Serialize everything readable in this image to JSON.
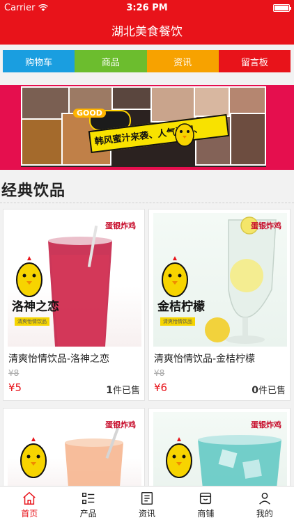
{
  "status": {
    "carrier": "Carrier",
    "time": "3:26 PM"
  },
  "nav": {
    "title": "湖北美食餐饮"
  },
  "menu": [
    {
      "label": "购物车",
      "color": "#1a9ee0"
    },
    {
      "label": "商品",
      "color": "#6cbd2e"
    },
    {
      "label": "资讯",
      "color": "#f7a200"
    },
    {
      "label": "留言板",
      "color": "#e8131a"
    }
  ],
  "banner": {
    "good": "GOOD",
    "slogan": "韩风蜜汁来袭、人气满棚、"
  },
  "section": {
    "title": "经典饮品"
  },
  "products": [
    {
      "brand": "蛋银炸鸡",
      "label": "洛神之恋",
      "sublabel": "清爽怡情饮品",
      "name": "清爽怡情饮品-洛神之恋",
      "old_price": "¥8",
      "price": "¥5",
      "sold_count": "1",
      "sold_suffix": "件已售"
    },
    {
      "brand": "蛋银炸鸡",
      "label": "金桔柠檬",
      "sublabel": "清爽怡情饮品",
      "name": "清爽怡情饮品-金桔柠檬",
      "old_price": "¥8",
      "price": "¥6",
      "sold_count": "0",
      "sold_suffix": "件已售"
    },
    {
      "brand": "蛋银炸鸡"
    },
    {
      "brand": "蛋银炸鸡"
    }
  ],
  "tabs": [
    {
      "label": "首页",
      "icon": "home-icon",
      "active": true
    },
    {
      "label": "产品",
      "icon": "list-icon"
    },
    {
      "label": "资讯",
      "icon": "news-icon"
    },
    {
      "label": "商铺",
      "icon": "shop-icon"
    },
    {
      "label": "我的",
      "icon": "user-icon"
    }
  ],
  "colors": {
    "primary": "#e8131a"
  }
}
